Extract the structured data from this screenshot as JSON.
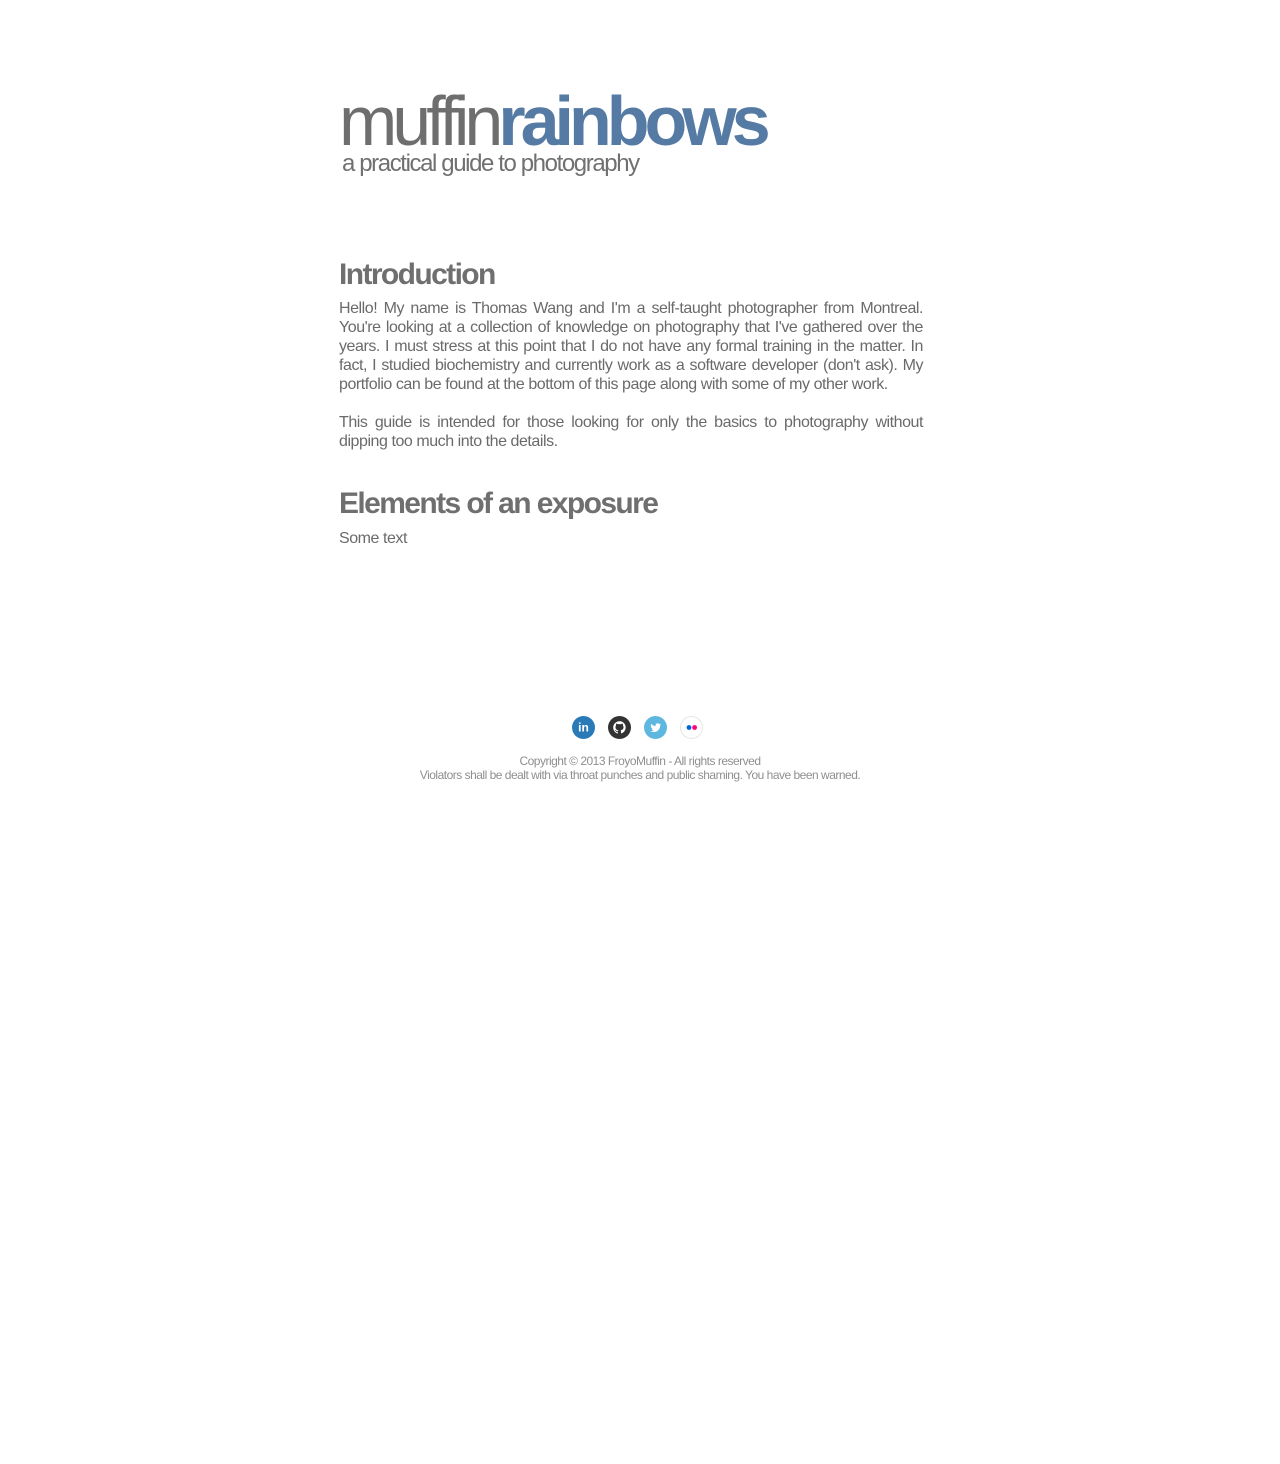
{
  "header": {
    "logo_part1": "muffin",
    "logo_part2": "rainbows",
    "tagline": "a practical guide to photography"
  },
  "sections": [
    {
      "title": "Introduction",
      "paragraphs": [
        "Hello! My name is Thomas Wang and I'm a self-taught photographer from Montreal. You're looking at a collection of knowledge on photography that I've gathered over the years. I must stress at this point that I do not have any formal training in the matter. In fact, I studied biochemistry and currently work as a software developer (don't ask). My portfolio can be found at the bottom of this page along with some of my other work.",
        "This guide is intended for those looking for only the basics to photography without dipping too much into the details."
      ]
    },
    {
      "title": "Elements of an exposure",
      "paragraphs": [
        "Some text"
      ]
    }
  ],
  "footer": {
    "social": [
      {
        "icon": "linkedin-icon",
        "label": "in",
        "color": "#2a7ab8"
      },
      {
        "icon": "github-icon",
        "label": "",
        "color": "#333333"
      },
      {
        "icon": "twitter-icon",
        "label": "",
        "color": "#5db7df"
      },
      {
        "icon": "flickr-icon",
        "label": "",
        "color": "#ffffff"
      }
    ],
    "copyright_line1": "Copyright © 2013 FroyoMuffin - All rights reserved",
    "copyright_line2": "Violators shall be dealt with via throat punches and public shaming. You have been warned."
  },
  "colors": {
    "brand_blue": "#557aa3",
    "text_gray": "#6b6b6b",
    "flickr_blue": "#0063dc",
    "flickr_pink": "#ff0084"
  }
}
